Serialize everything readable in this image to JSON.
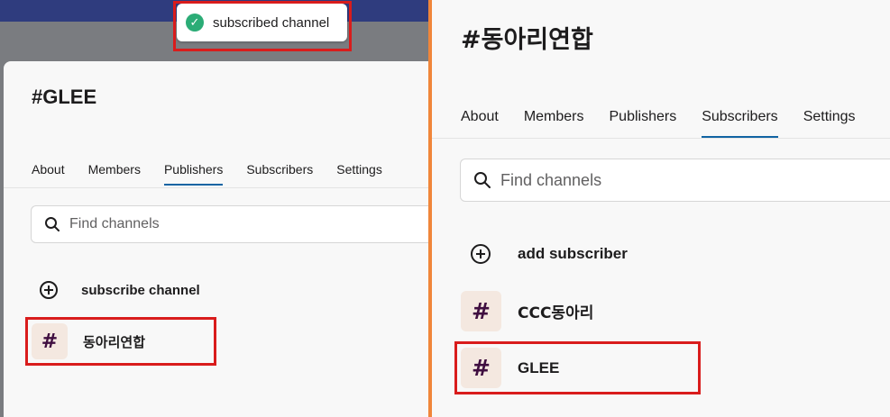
{
  "toast": {
    "message": "subscribed channel",
    "icon": "check-circle-icon"
  },
  "left_modal": {
    "title": "#GLEE",
    "tabs": [
      {
        "label": "About",
        "active": false
      },
      {
        "label": "Members",
        "active": false
      },
      {
        "label": "Publishers",
        "active": true
      },
      {
        "label": "Subscribers",
        "active": false
      },
      {
        "label": "Settings",
        "active": false
      }
    ],
    "search": {
      "placeholder": "Find channels"
    },
    "add_action": {
      "label": "subscribe channel"
    },
    "channels": [
      {
        "hash": "#",
        "name": "동아리연합"
      }
    ]
  },
  "right_panel": {
    "title": "#동아리연합",
    "tabs": [
      {
        "label": "About",
        "active": false
      },
      {
        "label": "Members",
        "active": false
      },
      {
        "label": "Publishers",
        "active": false
      },
      {
        "label": "Subscribers",
        "active": true
      },
      {
        "label": "Settings",
        "active": false
      }
    ],
    "search": {
      "placeholder": "Find channels"
    },
    "add_action": {
      "label": "add subscriber"
    },
    "channels": [
      {
        "hash": "#",
        "name": "CCC동아리"
      },
      {
        "hash": "#",
        "name": "GLEE"
      }
    ]
  },
  "colors": {
    "accent": "#1264a3",
    "highlight_box": "#d91c1c",
    "separator": "#f0863a",
    "toast_success": "#2bac76",
    "hash_tile_bg": "#f4e8e0",
    "hash_tile_fg": "#3f0e40"
  }
}
